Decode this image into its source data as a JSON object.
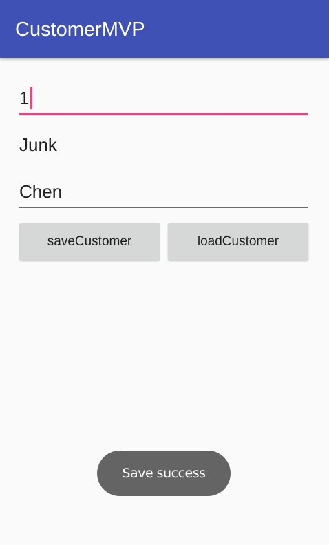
{
  "app_bar": {
    "title": "CustomerMVP"
  },
  "form": {
    "id_value": "1",
    "first_name_value": "Junk",
    "last_name_value": "Chen"
  },
  "buttons": {
    "save_label": "saveCustomer",
    "load_label": "loadCustomer"
  },
  "toast": {
    "message": "Save success"
  },
  "colors": {
    "primary": "#3f51b5",
    "accent": "#e4497e",
    "background": "#fafafa",
    "button": "#d6d7d7",
    "toast": "#646464"
  }
}
